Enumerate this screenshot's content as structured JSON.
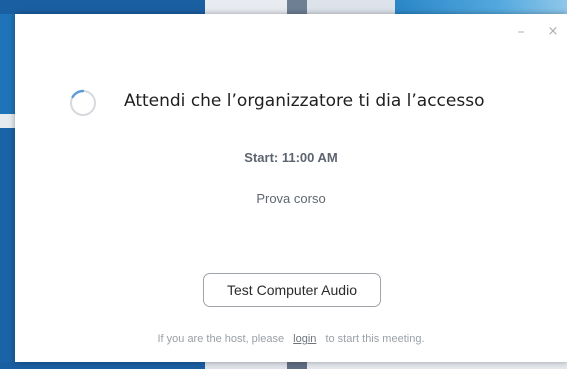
{
  "window": {
    "minimize_glyph": "–",
    "close_glyph": "×"
  },
  "waiting": {
    "message": "Attendi che l’organizzatore ti dia l’accesso",
    "spinner_color": "#5b9bd5"
  },
  "meeting": {
    "start_label": "Start: 11:00 AM",
    "topic": "Prova corso"
  },
  "actions": {
    "test_audio_label": "Test Computer Audio"
  },
  "host_prompt": {
    "prefix": "If you are the host, please",
    "link_label": "login",
    "suffix": "to start this meeting."
  }
}
